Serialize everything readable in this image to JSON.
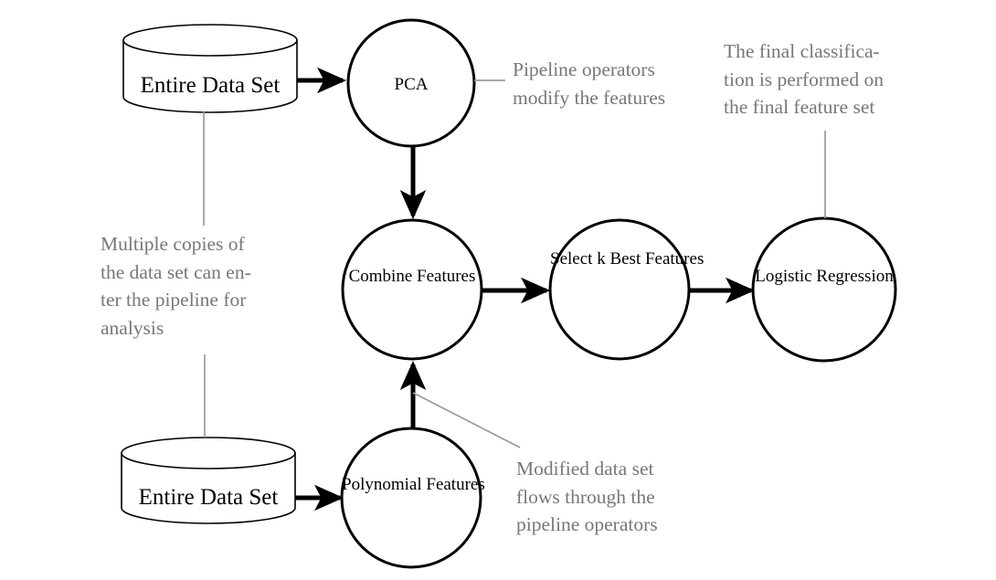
{
  "diagram": {
    "title": "Machine Learning Pipeline Flow Diagram",
    "colors": {
      "stroke": "#000000",
      "annotation_text": "#77777b",
      "leader_line": "#9a9a9e",
      "background": "#ffffff"
    },
    "data_sources": [
      {
        "id": "entire-data-set-top",
        "label": "Entire Data Set"
      },
      {
        "id": "entire-data-set-bottom",
        "label": "Entire Data Set"
      }
    ],
    "operators": [
      {
        "id": "pca",
        "lines": [
          "PCA"
        ]
      },
      {
        "id": "polynomial-features",
        "lines": [
          "Polynomial",
          "Features"
        ]
      },
      {
        "id": "combine-features",
        "lines": [
          "Combine",
          "Features"
        ]
      },
      {
        "id": "select-k-best-features",
        "lines": [
          "Select",
          "k  Best",
          "Features"
        ]
      },
      {
        "id": "logistic-regression",
        "lines": [
          "Logistic",
          "Regression"
        ]
      }
    ],
    "annotations": [
      {
        "id": "pipeline-operators-note",
        "lines": [
          "Pipeline operators",
          "modify the features"
        ]
      },
      {
        "id": "final-classification-note",
        "lines": [
          "The final classifica-",
          "tion is performed on",
          "the final feature set"
        ]
      },
      {
        "id": "multiple-copies-note",
        "lines": [
          "Multiple copies of",
          "the data set can en-",
          "ter the pipeline for",
          "analysis"
        ]
      },
      {
        "id": "modified-data-set-note",
        "lines": [
          "Modified data set",
          "flows through the",
          "pipeline operators"
        ]
      }
    ]
  }
}
